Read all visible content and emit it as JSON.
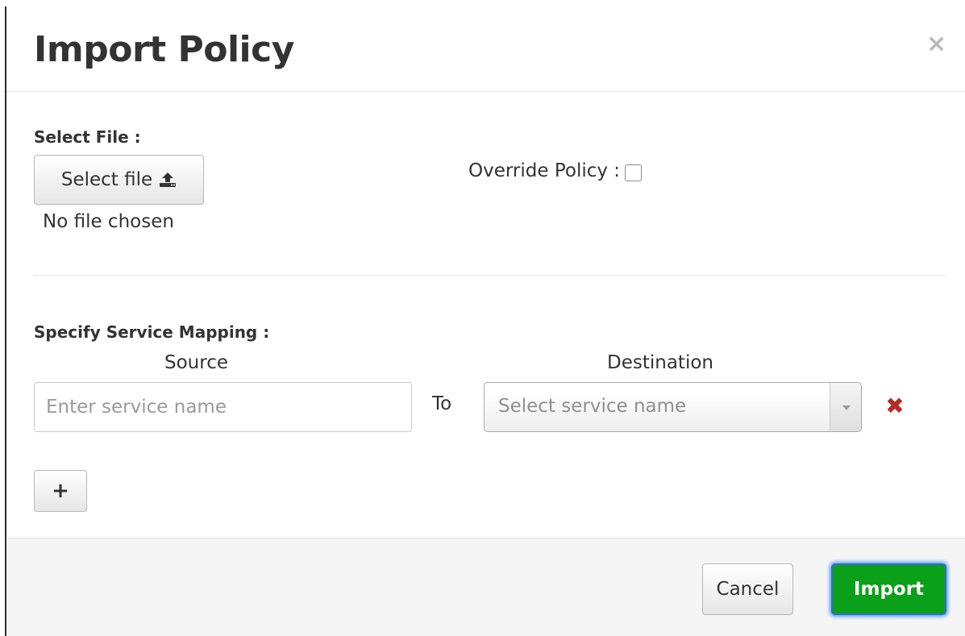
{
  "dialog": {
    "title": "Import Policy",
    "close_glyph": "×"
  },
  "file_section": {
    "label": "Select File :",
    "button_label": "Select file",
    "button_icon": "upload-icon",
    "status": "No file chosen"
  },
  "override": {
    "label": "Override Policy :",
    "checked": false
  },
  "mapping": {
    "label": "Specify Service Mapping :",
    "source_header": "Source",
    "destination_header": "Destination",
    "source_placeholder": "Enter service name",
    "source_value": "",
    "connector": "To",
    "destination_placeholder": "Select service name",
    "remove_glyph": "✖",
    "add_glyph": "+"
  },
  "footer": {
    "cancel_label": "Cancel",
    "import_label": "Import"
  },
  "colors": {
    "import_button": "#0aa01a",
    "remove_icon": "#b52b27",
    "focus_ring": "#5b9bf0"
  }
}
